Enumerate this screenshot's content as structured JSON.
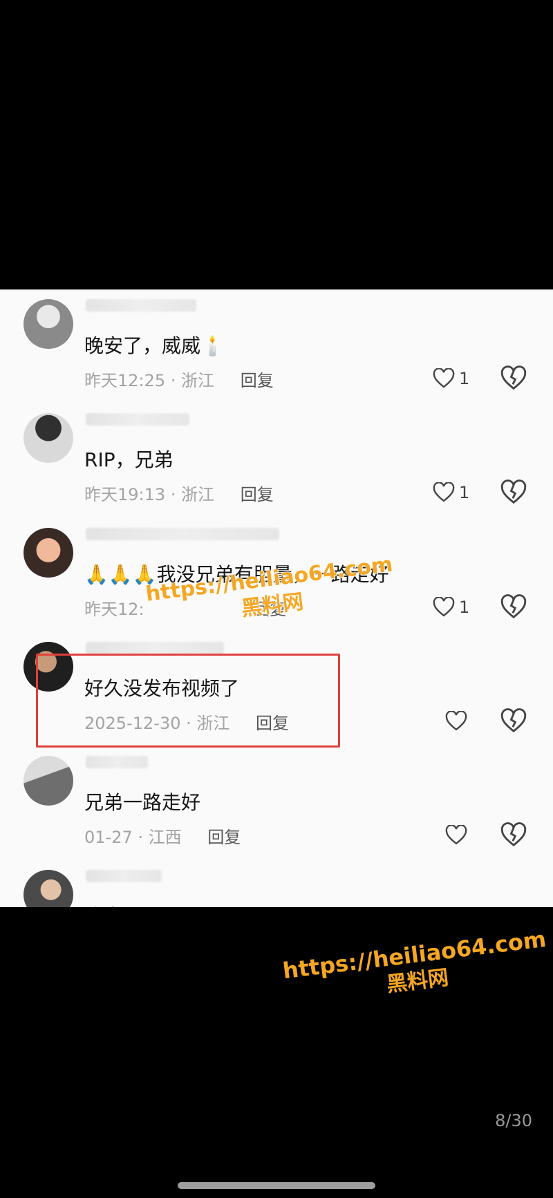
{
  "comments": [
    {
      "text": "晚安了，威威🕯️",
      "time": "昨天12:25",
      "location": "浙江",
      "reply_label": "回复",
      "likes": "1"
    },
    {
      "text": "RIP，兄弟",
      "time": "昨天19:13",
      "location": "浙江",
      "reply_label": "回复",
      "likes": "1"
    },
    {
      "text": "🙏🙏🙏我没兄弟有胆量，一路走好",
      "time": "昨天12:",
      "location": "",
      "reply_label": "回复",
      "likes": "1"
    },
    {
      "text": "好久没发布视频了",
      "time": "2025-12-30",
      "location": "浙江",
      "reply_label": "回复",
      "likes": ""
    },
    {
      "text": "兄弟一路走好",
      "time": "01-27",
      "location": "江西",
      "reply_label": "回复",
      "likes": ""
    },
    {
      "text": "晚安😊😊😊",
      "time": "",
      "location": "",
      "reply_label": "",
      "likes": ""
    }
  ],
  "separator": "·",
  "watermark": {
    "url": "https://heiliao64.com",
    "name": "黑料网"
  },
  "pager": "8/30",
  "colors": {
    "highlight_border": "#e0403b",
    "watermark": "#f5a623"
  },
  "icons": [
    "heart-icon",
    "broken-heart-icon"
  ]
}
